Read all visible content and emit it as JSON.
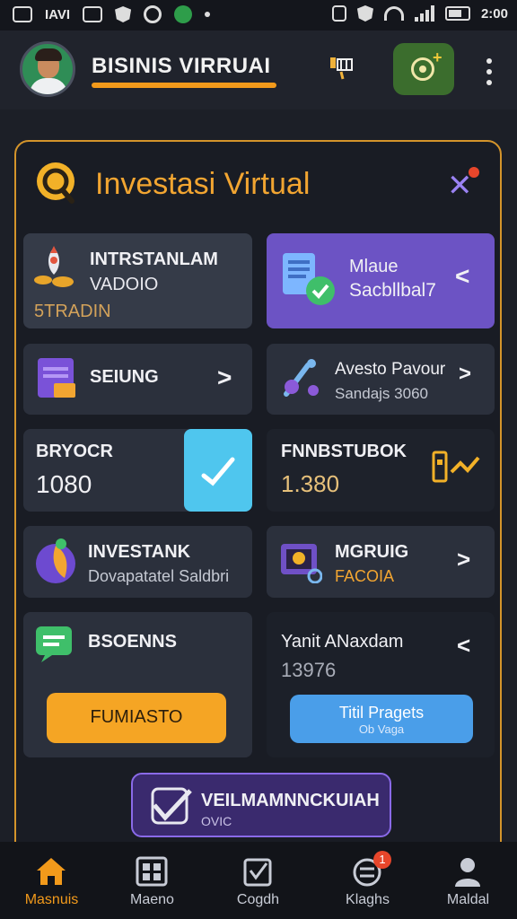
{
  "status_bar": {
    "left_text": "IAVI",
    "time": "2:00"
  },
  "header": {
    "title": "BISINIS VIRRUAI"
  },
  "panel": {
    "title": "Investasi Virtual",
    "cards": [
      {
        "title": "INTRSTANLAM",
        "subtitle": "VADOIO",
        "value": "5TRADIN"
      },
      {
        "title": "Mlaue",
        "subtitle": "Sacbllbal7"
      },
      {
        "title": "SEIUNG"
      },
      {
        "title": "Avesto Pavour",
        "subtitle": "Sandajs 3060"
      },
      {
        "title": "BRYOCR",
        "value": "1080"
      },
      {
        "title": "FNNBSTUBOK",
        "value": "1.380"
      },
      {
        "title": "INVESTANK",
        "subtitle": "Dovapatatel Saldbri"
      },
      {
        "title": "MGRUIG",
        "subtitle": "FACOIA"
      },
      {
        "title": "BSOENNS",
        "button": "FUMIASTO"
      },
      {
        "title": "Yanit ANaxdam",
        "value": "13976",
        "button_line1": "Titil Pragets",
        "button_line2": "Ob Vaga"
      }
    ],
    "cta": {
      "title": "VEILMAMNNCKUIAH",
      "subtitle": "OVIC"
    }
  },
  "nav": {
    "items": [
      {
        "label": "Masnuis",
        "active": true
      },
      {
        "label": "Maeno"
      },
      {
        "label": "Cogdh"
      },
      {
        "label": "Klaghs",
        "badge": "1"
      },
      {
        "label": "Maldal"
      }
    ]
  },
  "colors": {
    "accent": "#f29a1b",
    "purple": "#6c53c4",
    "blue": "#4aa3ef",
    "background": "#1c1f27"
  }
}
